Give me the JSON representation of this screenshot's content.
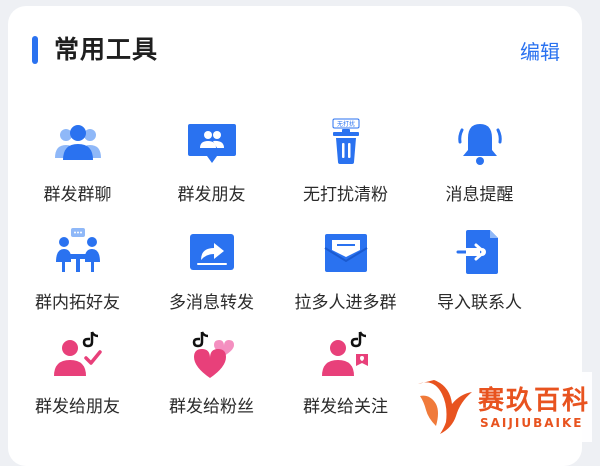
{
  "header": {
    "title": "常用工具",
    "edit_label": "编辑"
  },
  "colors": {
    "accent": "#2a72f0",
    "pink": "#e8407a",
    "tiktok": "#111111",
    "brand": "#e8531f"
  },
  "tools": [
    {
      "label": "群发群聊",
      "icon": "group-chat-icon"
    },
    {
      "label": "群发朋友",
      "icon": "friend-message-icon"
    },
    {
      "label": "无打扰清粉",
      "icon": "trash-clean-icon",
      "badge": "无打扰"
    },
    {
      "label": "消息提醒",
      "icon": "bell-icon"
    },
    {
      "label": "群内拓好友",
      "icon": "group-meeting-icon"
    },
    {
      "label": "多消息转发",
      "icon": "forward-icon"
    },
    {
      "label": "拉多人进多群",
      "icon": "mail-inbox-icon"
    },
    {
      "label": "导入联系人",
      "icon": "import-icon"
    },
    {
      "label": "群发给朋友",
      "icon": "tiktok-friend-icon"
    },
    {
      "label": "群发给粉丝",
      "icon": "tiktok-fans-icon"
    },
    {
      "label": "群发给关注",
      "icon": "tiktok-follow-icon"
    }
  ],
  "watermark": {
    "brand_cn": "赛玖百科",
    "brand_en": "SAIJIUBAIKE"
  }
}
